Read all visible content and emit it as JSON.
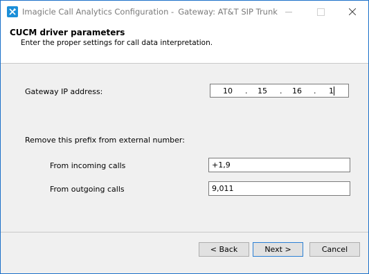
{
  "window": {
    "app_title": "Imagicle Call Analytics Configuration -",
    "gateway_title": "Gateway: AT&T SIP Trunk"
  },
  "header": {
    "title": "CUCM driver parameters",
    "subtitle": "Enter the proper settings for call data interpretation."
  },
  "form": {
    "gateway_ip_label": "Gateway IP address:",
    "gateway_ip": {
      "octet1": "10",
      "octet2": "15",
      "octet3": "16",
      "octet4": "1",
      "dot": "."
    },
    "prefix_section_label": "Remove this prefix from external number:",
    "incoming_label": "From incoming calls",
    "incoming_value": "+1,9",
    "outgoing_label": "From outgoing calls",
    "outgoing_value": "9,011"
  },
  "buttons": {
    "back": "< Back",
    "next": "Next >",
    "cancel": "Cancel"
  }
}
